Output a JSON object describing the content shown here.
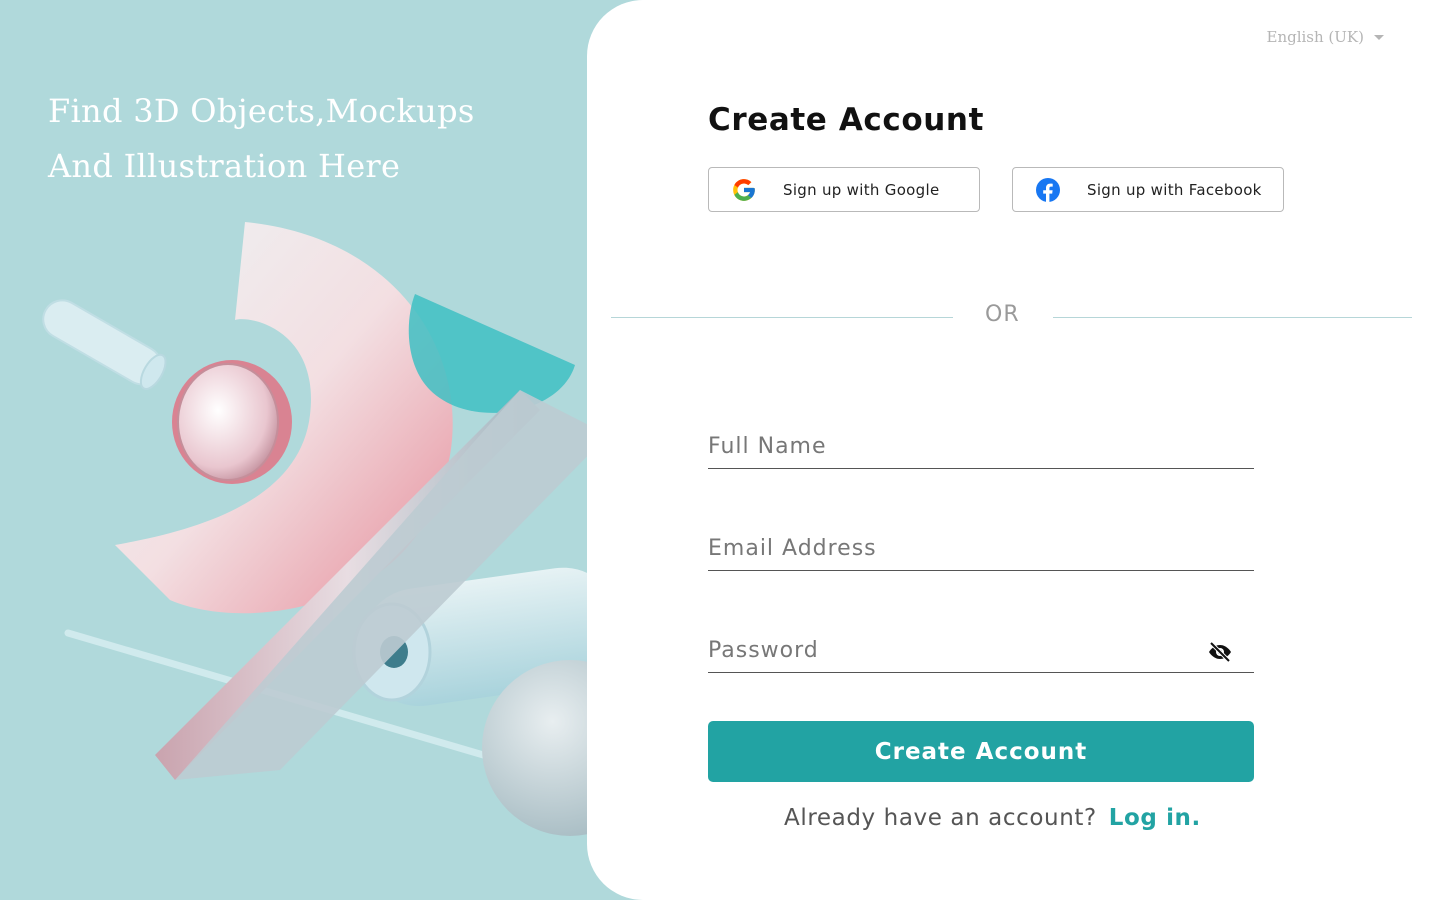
{
  "hero": {
    "line1": "Find 3D Objects,Mockups",
    "line2": "And Illustration Here"
  },
  "language": {
    "selected": "English (UK)",
    "icon": "chevron-down-icon"
  },
  "form": {
    "title": "Create Account",
    "google_label": "Sign up with Google",
    "facebook_label": "Sign up with Facebook",
    "divider_text": "OR",
    "full_name_placeholder": "Full Name",
    "email_placeholder": "Email Address",
    "password_placeholder": "Password",
    "password_toggle_icon": "eye-off-icon",
    "submit_label": "Create Account",
    "login_prompt": "Already have an account?",
    "login_link": "Log in."
  },
  "colors": {
    "accent": "#22a3a3",
    "left_bg": "#b0d9db",
    "facebook": "#1877f2"
  }
}
